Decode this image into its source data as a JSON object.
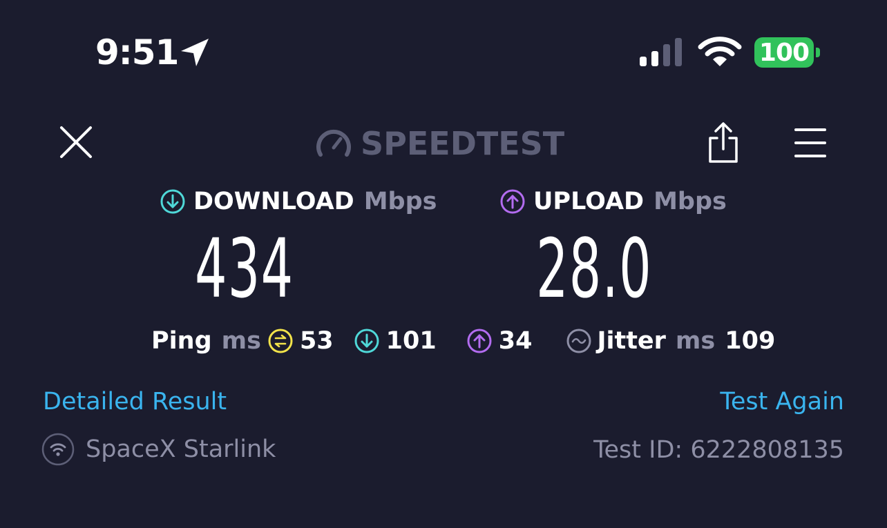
{
  "status_bar": {
    "time": "9:51",
    "location_icon": "location-arrow-icon",
    "signal_icon": "cellular-signal-icon",
    "wifi_icon": "wifi-icon",
    "battery": "100",
    "battery_color": "#31c25b"
  },
  "header": {
    "close_icon": "close-icon",
    "logo_icon": "speedometer-icon",
    "logo_text": "SPEEDTEST",
    "share_icon": "share-icon",
    "menu_icon": "hamburger-menu-icon"
  },
  "download": {
    "label": "DOWNLOAD",
    "unit": "Mbps",
    "value": "434",
    "icon": "download-arrow-icon",
    "color": "#4fd8d8"
  },
  "upload": {
    "label": "UPLOAD",
    "unit": "Mbps",
    "value": "28.0",
    "icon": "upload-arrow-icon",
    "color": "#b36cf0"
  },
  "ping": {
    "label": "Ping",
    "unit": "ms",
    "idle_value": "53",
    "idle_icon": "ping-idle-icon",
    "idle_color": "#f2e34a",
    "download_value": "101",
    "upload_value": "34"
  },
  "jitter": {
    "label": "Jitter",
    "unit": "ms",
    "value": "109",
    "icon": "jitter-wave-icon"
  },
  "links": {
    "detailed_result": "Detailed Result",
    "test_again": "Test Again"
  },
  "footer": {
    "provider": "SpaceX Starlink",
    "provider_icon": "wifi-circle-icon",
    "test_id": "Test ID: 6222808135"
  }
}
